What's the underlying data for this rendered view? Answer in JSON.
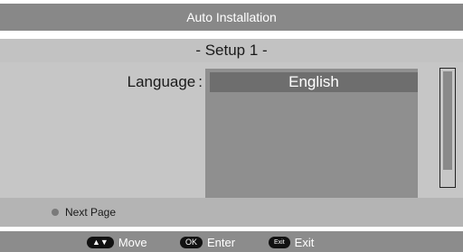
{
  "header": {
    "title": "Auto Installation",
    "step": "- Setup 1 -"
  },
  "language": {
    "label": "Language",
    "separator": ":",
    "selected": "English"
  },
  "footer": {
    "next_page": "Next Page"
  },
  "nav": {
    "move_key": "▲▼",
    "move_label": "Move",
    "enter_key": "OK",
    "enter_label": "Enter",
    "exit_key": "Exit",
    "exit_label": "Exit"
  },
  "colors": {
    "title_bar": "#888888",
    "content_bg": "#c6c6c6",
    "list_bg": "#8f8f8f",
    "selected_item": "#6e6e6e",
    "nav_bar": "#8c8c8c"
  }
}
